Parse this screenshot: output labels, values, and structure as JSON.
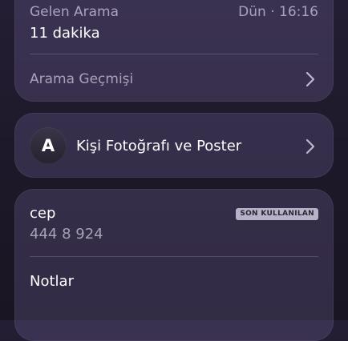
{
  "recent_call": {
    "type": "Gelen Arama",
    "time": "Dün · 16:16",
    "duration": "11 dakika"
  },
  "call_history": {
    "label": "Arama Geçmişi",
    "icon": "chevron-right-icon"
  },
  "contact_poster": {
    "avatar_letter": "A",
    "label": "Kişi Fotoğrafı ve Poster",
    "icon": "chevron-right-icon"
  },
  "phone": {
    "label": "cep",
    "badge": "SON KULLANILAN",
    "number": "444 8 924"
  },
  "notes": {
    "label": "Notlar"
  }
}
